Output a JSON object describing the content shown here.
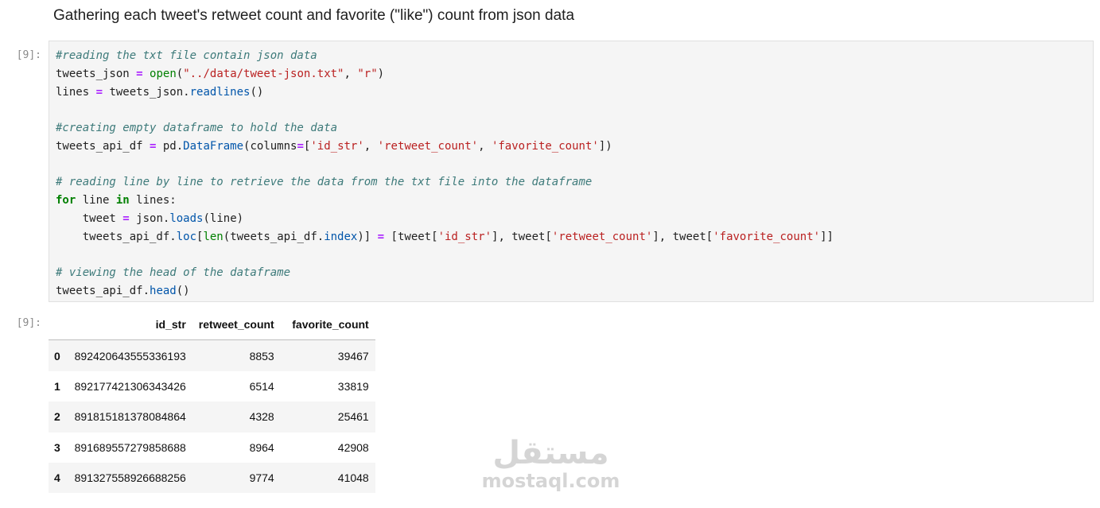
{
  "markdown": {
    "heading": "Gathering each tweet's retweet count and favorite (\"like\") count from json data"
  },
  "code_cell": {
    "prompt": "[9]:",
    "lines": [
      [
        {
          "t": "cm",
          "v": "#reading the txt file contain json data"
        }
      ],
      [
        {
          "t": "nm",
          "v": "tweets_json "
        },
        {
          "t": "op",
          "v": "="
        },
        {
          "t": "nm",
          "v": " "
        },
        {
          "t": "bi",
          "v": "open"
        },
        {
          "t": "br",
          "v": "("
        },
        {
          "t": "st",
          "v": "\"../data/tweet-json.txt\""
        },
        {
          "t": "nm",
          "v": ", "
        },
        {
          "t": "st",
          "v": "\"r\""
        },
        {
          "t": "br",
          "v": ")"
        }
      ],
      [
        {
          "t": "nm",
          "v": "lines "
        },
        {
          "t": "op",
          "v": "="
        },
        {
          "t": "nm",
          "v": " tweets_json."
        },
        {
          "t": "fn",
          "v": "readlines"
        },
        {
          "t": "br",
          "v": "()"
        }
      ],
      [],
      [
        {
          "t": "cm",
          "v": "#creating empty dataframe to hold the data"
        }
      ],
      [
        {
          "t": "nm",
          "v": "tweets_api_df "
        },
        {
          "t": "op",
          "v": "="
        },
        {
          "t": "nm",
          "v": " pd."
        },
        {
          "t": "fn",
          "v": "DataFrame"
        },
        {
          "t": "br",
          "v": "("
        },
        {
          "t": "nm",
          "v": "columns"
        },
        {
          "t": "op",
          "v": "="
        },
        {
          "t": "br",
          "v": "["
        },
        {
          "t": "st",
          "v": "'id_str'"
        },
        {
          "t": "nm",
          "v": ", "
        },
        {
          "t": "st",
          "v": "'retweet_count'"
        },
        {
          "t": "nm",
          "v": ", "
        },
        {
          "t": "st",
          "v": "'favorite_count'"
        },
        {
          "t": "br",
          "v": "])"
        }
      ],
      [],
      [
        {
          "t": "cm",
          "v": "# reading line by line to retrieve the data from the txt file into the dataframe"
        }
      ],
      [
        {
          "t": "kw",
          "v": "for"
        },
        {
          "t": "nm",
          "v": " line "
        },
        {
          "t": "kw",
          "v": "in"
        },
        {
          "t": "nm",
          "v": " lines:"
        }
      ],
      [
        {
          "t": "nm",
          "v": "    tweet "
        },
        {
          "t": "op",
          "v": "="
        },
        {
          "t": "nm",
          "v": " json."
        },
        {
          "t": "fn",
          "v": "loads"
        },
        {
          "t": "br",
          "v": "("
        },
        {
          "t": "nm",
          "v": "line"
        },
        {
          "t": "br",
          "v": ")"
        }
      ],
      [
        {
          "t": "nm",
          "v": "    tweets_api_df."
        },
        {
          "t": "fn",
          "v": "loc"
        },
        {
          "t": "br",
          "v": "["
        },
        {
          "t": "bi",
          "v": "len"
        },
        {
          "t": "br",
          "v": "("
        },
        {
          "t": "nm",
          "v": "tweets_api_df."
        },
        {
          "t": "fn",
          "v": "index"
        },
        {
          "t": "br",
          "v": ")]"
        },
        {
          "t": "nm",
          "v": " "
        },
        {
          "t": "op",
          "v": "="
        },
        {
          "t": "nm",
          "v": " "
        },
        {
          "t": "br",
          "v": "["
        },
        {
          "t": "nm",
          "v": "tweet"
        },
        {
          "t": "br",
          "v": "["
        },
        {
          "t": "st",
          "v": "'id_str'"
        },
        {
          "t": "br",
          "v": "]"
        },
        {
          "t": "nm",
          "v": ", tweet"
        },
        {
          "t": "br",
          "v": "["
        },
        {
          "t": "st",
          "v": "'retweet_count'"
        },
        {
          "t": "br",
          "v": "]"
        },
        {
          "t": "nm",
          "v": ", tweet"
        },
        {
          "t": "br",
          "v": "["
        },
        {
          "t": "st",
          "v": "'favorite_count'"
        },
        {
          "t": "br",
          "v": "]]"
        }
      ],
      [],
      [
        {
          "t": "cm",
          "v": "# viewing the head of the dataframe"
        }
      ],
      [
        {
          "t": "nm",
          "v": "tweets_api_df."
        },
        {
          "t": "fn",
          "v": "head"
        },
        {
          "t": "br",
          "v": "()"
        }
      ]
    ]
  },
  "output_cell": {
    "prompt": "[9]:",
    "table": {
      "index_header": "",
      "columns": [
        "id_str",
        "retweet_count",
        "favorite_count"
      ],
      "rows": [
        {
          "index": "0",
          "values": [
            "892420643555336193",
            "8853",
            "39467"
          ]
        },
        {
          "index": "1",
          "values": [
            "892177421306343426",
            "6514",
            "33819"
          ]
        },
        {
          "index": "2",
          "values": [
            "891815181378084864",
            "4328",
            "25461"
          ]
        },
        {
          "index": "3",
          "values": [
            "891689557279858688",
            "8964",
            "42908"
          ]
        },
        {
          "index": "4",
          "values": [
            "891327558926688256",
            "9774",
            "41048"
          ]
        }
      ]
    }
  },
  "watermark": {
    "arabic": "مستقل",
    "latin": "mostaql.com"
  },
  "colors": {
    "comment": "#3d7a7a",
    "keyword": "#008000",
    "operator": "#aa22ff",
    "string": "#ba2121",
    "code_background": "#f5f5f5"
  }
}
